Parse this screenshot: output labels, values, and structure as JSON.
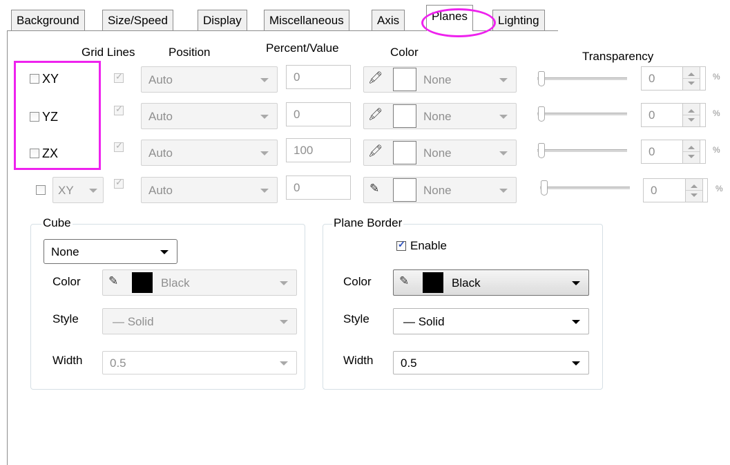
{
  "tabs": [
    "Background",
    "Size/Speed",
    "Display",
    "Miscellaneous",
    "Axis",
    "Planes",
    "Lighting"
  ],
  "active_tab": "Planes",
  "headers": {
    "grid_lines": "Grid Lines",
    "position": "Position",
    "percent_value": "Percent/Value",
    "color": "Color",
    "transparency": "Transparency"
  },
  "plane_rows": [
    {
      "label": "XY",
      "position": "Auto",
      "value": "0",
      "color": "None",
      "transparency": "0"
    },
    {
      "label": "YZ",
      "position": "Auto",
      "value": "0",
      "color": "None",
      "transparency": "0"
    },
    {
      "label": "ZX",
      "position": "Auto",
      "value": "100",
      "color": "None",
      "transparency": "0"
    },
    {
      "label": "XY",
      "position": "Auto",
      "value": "0",
      "color": "None",
      "transparency": "0"
    }
  ],
  "percent_unit": "%",
  "cube": {
    "title": "Cube",
    "type": "None",
    "color_label": "Color",
    "color": "Black",
    "style_label": "Style",
    "style": "Solid",
    "width_label": "Width",
    "width": "0.5"
  },
  "plane_border": {
    "title": "Plane Border",
    "enable_label": "Enable",
    "enabled": true,
    "color_label": "Color",
    "color": "Black",
    "style_label": "Style",
    "style": "Solid",
    "width_label": "Width",
    "width": "0.5"
  },
  "colors": {
    "highlight": "#ee22ee",
    "check_blue": "#2a4fbf"
  }
}
